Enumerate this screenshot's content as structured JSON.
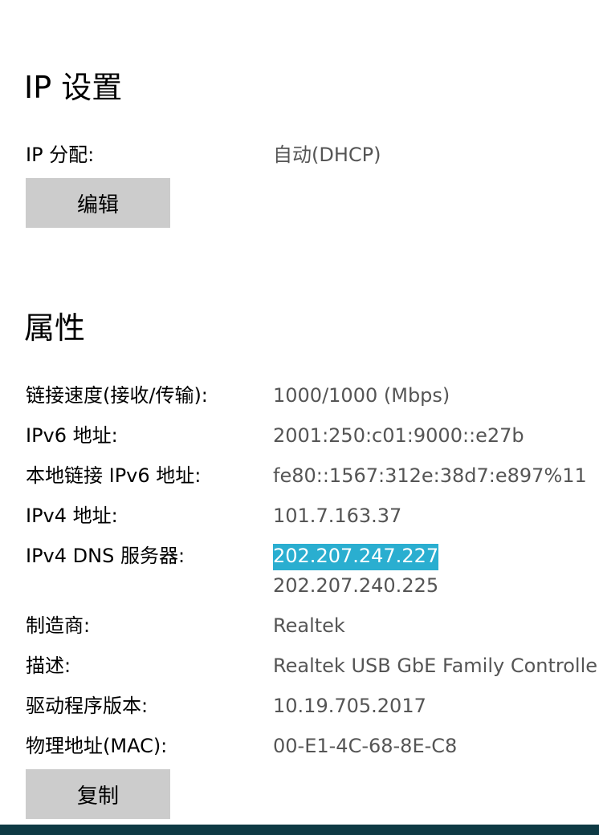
{
  "ip_settings": {
    "title": "IP 设置",
    "assignment_label": "IP 分配:",
    "assignment_value": "自动(DHCP)",
    "edit_button": "编辑"
  },
  "properties": {
    "title": "属性",
    "link_speed_label": "链接速度(接收/传输):",
    "link_speed_value": "1000/1000 (Mbps)",
    "ipv6_label": "IPv6 地址:",
    "ipv6_value": "2001:250:c01:9000::e27b",
    "link_local_ipv6_label": "本地链接 IPv6 地址:",
    "link_local_ipv6_value": "fe80::1567:312e:38d7:e897%11",
    "ipv4_label": "IPv4 地址:",
    "ipv4_value": "101.7.163.37",
    "dns_label": "IPv4 DNS 服务器:",
    "dns_values": [
      "202.207.247.227",
      "202.207.240.225"
    ],
    "manufacturer_label": "制造商:",
    "manufacturer_value": "Realtek",
    "description_label": "描述:",
    "description_value": "Realtek USB GbE Family Controller",
    "driver_label": "驱动程序版本:",
    "driver_value": "10.19.705.2017",
    "mac_label": "物理地址(MAC):",
    "mac_value": "00-E1-4C-68-8E-C8",
    "copy_button": "复制"
  },
  "colors": {
    "selection": "#2aaed0",
    "button_bg": "#cccccc",
    "value_text": "#555555",
    "taskbar": "#0e3a44"
  }
}
